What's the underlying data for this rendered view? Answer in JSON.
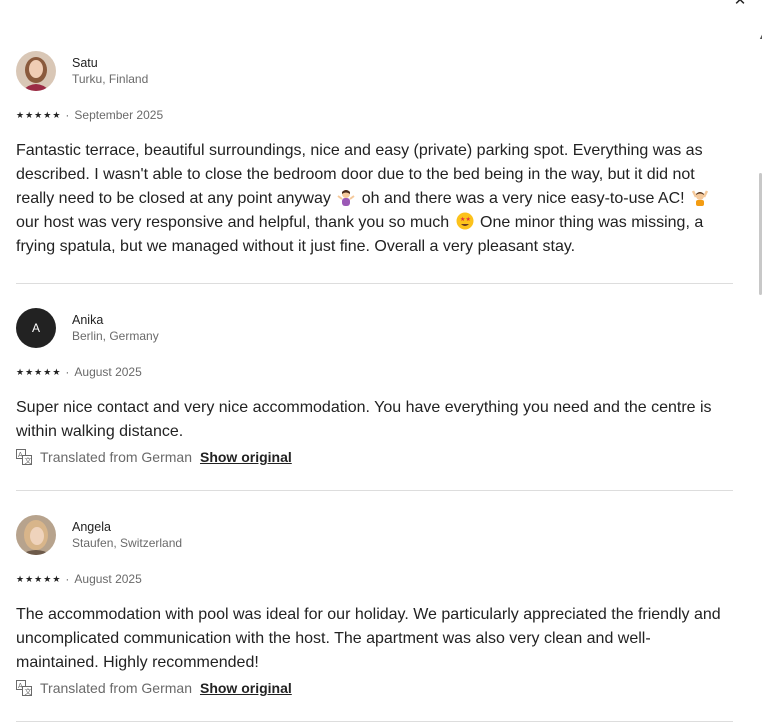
{
  "dialog": {
    "close_glyph": "✕"
  },
  "reviews": [
    {
      "name": "Satu",
      "location": "Turku, Finland",
      "rating": 5,
      "date": "September 2025",
      "separator": "·",
      "text_parts": [
        "Fantastic terrace, beautiful surroundings, nice and easy (private) parking spot. Everything was as described. I wasn't able to close the bedroom door due to the bed being in the way, but it did not really need to be closed at any point anyway ",
        " oh and there was a very nice easy-to-use AC! ",
        " our host was very responsive and helpful, thank you so much ",
        " One minor thing was missing, a frying spatula, but we managed without it just fine. Overall a very pleasant stay."
      ],
      "emojis": [
        "person-shrugging-emoji",
        "raising-hands-emoji",
        "star-struck-emoji"
      ]
    },
    {
      "name": "Anika",
      "location": "Berlin, Germany",
      "avatar_initial": "A",
      "rating": 5,
      "date": "August 2025",
      "separator": "·",
      "text": "Super nice contact and very nice accommodation. You have everything you need and the centre is within walking distance.",
      "translated_label": "Translated from German",
      "show_original_label": "Show original"
    },
    {
      "name": "Angela",
      "location": "Staufen, Switzerland",
      "rating": 5,
      "date": "August 2025",
      "separator": "·",
      "text": "The accommodation with pool was ideal for our holiday. We particularly appreciated the friendly and uncomplicated communication with the host. The apartment was also very clean and well-maintained. Highly recommended!",
      "translated_label": "Translated from German",
      "show_original_label": "Show original"
    }
  ],
  "star_glyph": "★",
  "colors": {
    "text": "#222222",
    "muted": "#6a6a6a",
    "divider": "#dddddd"
  }
}
